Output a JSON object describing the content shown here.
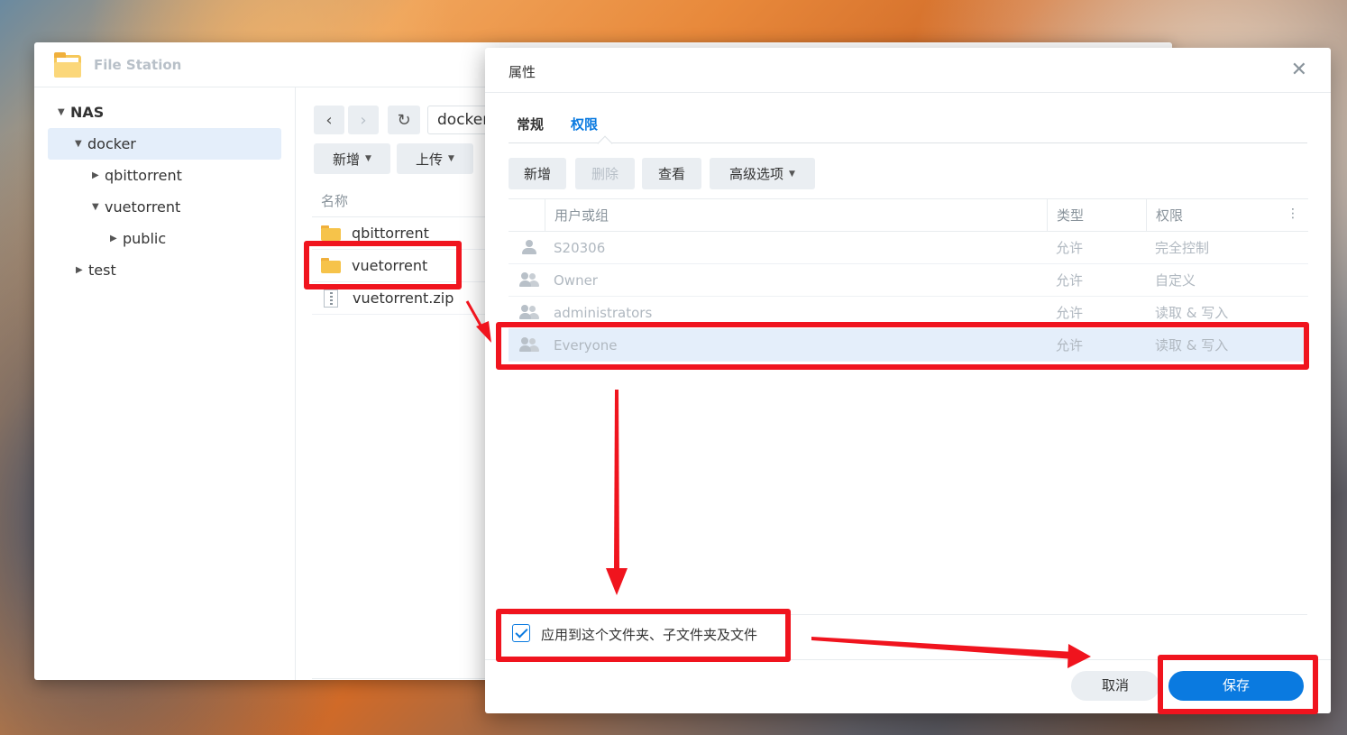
{
  "file_station": {
    "title": "File Station",
    "tree": {
      "root": "NAS",
      "items": [
        {
          "label": "docker"
        },
        {
          "label": "qbittorrent"
        },
        {
          "label": "vuetorrent"
        },
        {
          "label": "public"
        },
        {
          "label": "test"
        }
      ]
    },
    "path": "docker",
    "toolbar": {
      "new_label": "新增",
      "upload_label": "上传"
    },
    "list": {
      "column_name": "名称",
      "files": [
        {
          "name": "qbittorrent",
          "icon": "folder-icon"
        },
        {
          "name": "vuetorrent",
          "icon": "folder-icon"
        },
        {
          "name": "vuetorrent.zip",
          "icon": "zip-file-icon"
        }
      ]
    }
  },
  "dialog": {
    "title": "属性",
    "close": "✕",
    "tabs": [
      {
        "label": "常规"
      },
      {
        "label": "权限"
      }
    ],
    "toolbar": {
      "add": "新增",
      "delete": "删除",
      "view": "查看",
      "advanced": "高级选项"
    },
    "columns": {
      "user": "用户或组",
      "type": "类型",
      "permission": "权限"
    },
    "rows": [
      {
        "name": "S20306",
        "type": "允许",
        "permission": "完全控制",
        "icon": "user-icon"
      },
      {
        "name": "Owner",
        "type": "允许",
        "permission": "自定义",
        "icon": "group-icon"
      },
      {
        "name": "administrators",
        "type": "允许",
        "permission": "读取 & 写入",
        "icon": "group-icon"
      },
      {
        "name": "Everyone",
        "type": "允许",
        "permission": "读取 & 写入",
        "icon": "group-icon"
      }
    ],
    "apply_label": "应用到这个文件夹、子文件夹及文件",
    "apply_checked": true,
    "cancel_label": "取消",
    "save_label": "保存"
  },
  "colors": {
    "accent": "#0a7ae0",
    "annotation": "#f0141e",
    "selection": "#e4eefa"
  }
}
